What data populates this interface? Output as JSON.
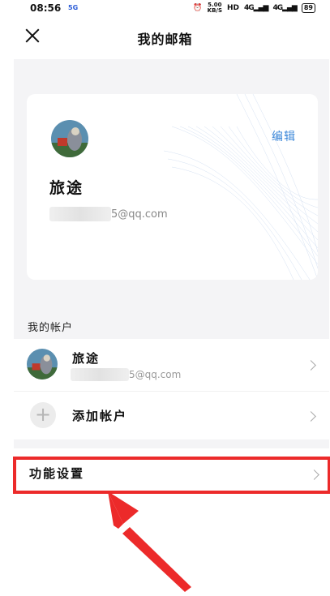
{
  "status_bar": {
    "time": "08:56",
    "network": "5G",
    "speed_value": "5.00",
    "speed_unit": "KB/S",
    "hd": "HD",
    "signal1": "4G",
    "signal2": "4G",
    "battery": "89"
  },
  "header": {
    "title": "我的邮箱",
    "close_icon": "close-icon"
  },
  "profile_card": {
    "name": "旅途",
    "email_visible": "5@qq.com",
    "edit_label": "编辑"
  },
  "accounts_section": {
    "label": "我的帐户",
    "accounts": [
      {
        "name": "旅途",
        "email_visible": "5@qq.com"
      }
    ],
    "add_label": "添加帐户"
  },
  "settings_row": {
    "label": "功能设置"
  },
  "colors": {
    "accent": "#3a86d8",
    "highlight": "#ec2a2a",
    "background": "#f4f4f6"
  }
}
